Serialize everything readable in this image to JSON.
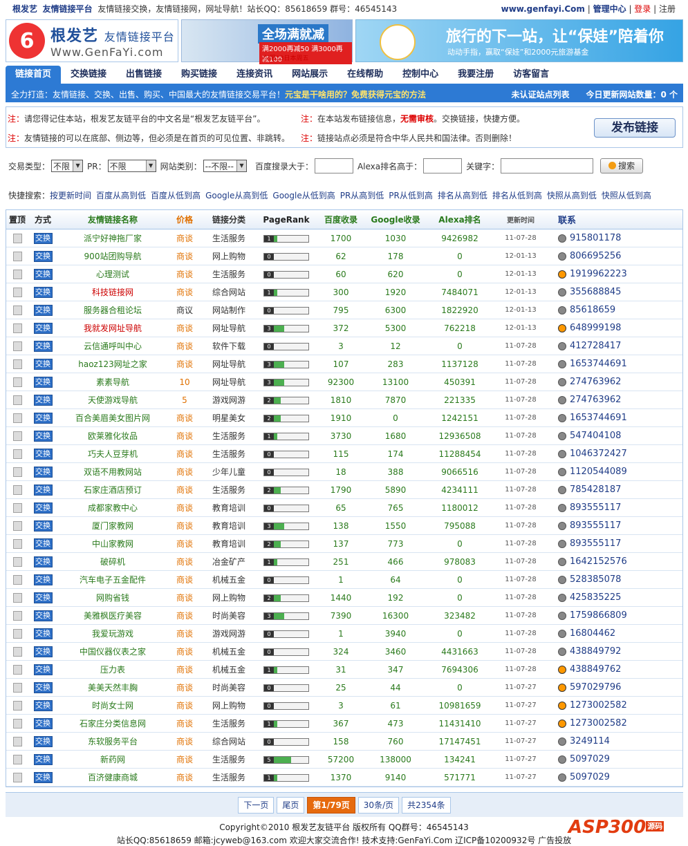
{
  "topbar": {
    "brand": "根发艺",
    "subtitle": "友情链接平台",
    "slogan": "友情链接交换，友情链接网，网址导航！站长QQ：85618659 群号：46545143",
    "site_url": "www.genfayi.Com",
    "admin": "管理中心",
    "login": "登录",
    "register": "注册"
  },
  "header": {
    "logo_cn": "根发艺",
    "logo_tag": "友情链接平台",
    "logo_en": "Www.GenFaYi.com",
    "ad1_title": "全场满就减",
    "ad1_sub": "满2000再减50 满3000再减100",
    "ad1_note": "仅限13日本周五",
    "ad2_title": "旅行的下一站，让“保娃”陪着你",
    "ad2_sub": "动动手指，赢取“保娃”和2000元旅游基金"
  },
  "nav": [
    "链接首页",
    "交换链接",
    "出售链接",
    "购买链接",
    "连接资讯",
    "网站展示",
    "在线帮助",
    "控制中心",
    "我要注册",
    "访客留言"
  ],
  "subnav": {
    "left": "全力打造：友情链接、交换、出售、购买、中国最大的友情链接交易平台！",
    "highlight": "元宝是干啥用的？免费获得元宝的方法",
    "middle": "未认证站点列表",
    "right": "今日更新网站数量：0 个"
  },
  "notice": {
    "prefix": "注：",
    "n1": "请您得记住本站，根发艺友链平台的中文名是“根发艺友链平台”。",
    "n2a": "在本站发布链接信息，",
    "n2b": "无需审核",
    "n2c": "。交换链接，快捷方便。",
    "n3": "友情链接的可以在底部、侧边等，但必须是在首页的可见位置、非跳转。",
    "n4": "链接站点必须是符合中华人民共和国法律。否则删除！",
    "publish": "发布链接"
  },
  "search": {
    "type_label": "交易类型：",
    "type_value": "不限",
    "pr_label": "PR：",
    "pr_value": "不限",
    "cat_label": "网站类别：",
    "cat_value": "--不限--",
    "baidu_label": "百度搜录大于：",
    "alexa_label": "Alexa排名高于：",
    "kw_label": "关键字：",
    "btn": "搜索"
  },
  "quick": {
    "label": "快捷搜索：",
    "items": [
      "按更新时间",
      "百度从高到低",
      "百度从低到高",
      "Google从高到低",
      "Google从低到高",
      "PR从高到低",
      "PR从低到高",
      "排名从高到低",
      "排名从低到高",
      "快照从高到低",
      "快照从低到高"
    ]
  },
  "table": {
    "headers": [
      "置顶",
      "方式",
      "友情链接名称",
      "价格",
      "链接分类",
      "PageRank",
      "百度收录",
      "Google收录",
      "Alexa排名",
      "更新时间",
      "联系"
    ],
    "mode_label": "交换",
    "rows": [
      {
        "name": "派宁好神拖厂家",
        "price": "商谈",
        "cat": "生活服务",
        "pr": 1,
        "baidu": "1700",
        "google": "1030",
        "alexa": "9426982",
        "time": "11-07-28",
        "qq": "915801178",
        "qqcolor": false
      },
      {
        "name": "900站团购导航",
        "price": "商谈",
        "cat": "网上购物",
        "pr": 0,
        "baidu": "62",
        "google": "178",
        "alexa": "0",
        "time": "12-01-13",
        "qq": "806695256",
        "qqcolor": false
      },
      {
        "name": "心理测试",
        "price": "商谈",
        "cat": "生活服务",
        "pr": 0,
        "baidu": "60",
        "google": "620",
        "alexa": "0",
        "time": "12-01-13",
        "qq": "1919962223",
        "qqcolor": true
      },
      {
        "name": "科技链接网",
        "price": "商谈",
        "cat": "综合网站",
        "pr": 1,
        "baidu": "300",
        "google": "1920",
        "alexa": "7484071",
        "time": "12-01-13",
        "qq": "355688845",
        "qqcolor": false,
        "red": true
      },
      {
        "name": "服务器合租论坛",
        "price": "商议",
        "cat": "网站制作",
        "pr": 0,
        "baidu": "795",
        "google": "6300",
        "alexa": "1822920",
        "time": "12-01-13",
        "qq": "85618659",
        "qqcolor": false,
        "blk": true
      },
      {
        "name": "我就发网址导航",
        "price": "商谈",
        "cat": "网址导航",
        "pr": 3,
        "baidu": "372",
        "google": "5300",
        "alexa": "762218",
        "time": "12-01-13",
        "qq": "648999198",
        "qqcolor": true,
        "red": true
      },
      {
        "name": "云信通呼叫中心",
        "price": "商谈",
        "cat": "软件下载",
        "pr": 0,
        "baidu": "3",
        "google": "12",
        "alexa": "0",
        "time": "11-07-28",
        "qq": "412728417",
        "qqcolor": false
      },
      {
        "name": "haoz123网址之家",
        "price": "商谈",
        "cat": "网址导航",
        "pr": 3,
        "baidu": "107",
        "google": "283",
        "alexa": "1137128",
        "time": "11-07-28",
        "qq": "1653744691",
        "qqcolor": false
      },
      {
        "name": "素素导航",
        "price": "10",
        "cat": "网址导航",
        "pr": 3,
        "baidu": "92300",
        "google": "13100",
        "alexa": "450391",
        "time": "11-07-28",
        "qq": "274763962",
        "qqcolor": false
      },
      {
        "name": "天使游戏导航",
        "price": "5",
        "cat": "游戏网游",
        "pr": 2,
        "baidu": "1810",
        "google": "7870",
        "alexa": "221335",
        "time": "11-07-28",
        "qq": "274763962",
        "qqcolor": false
      },
      {
        "name": "百合美眉美女图片网",
        "price": "商谈",
        "cat": "明星美女",
        "pr": 2,
        "baidu": "1910",
        "google": "0",
        "alexa": "1242151",
        "time": "11-07-28",
        "qq": "1653744691",
        "qqcolor": false
      },
      {
        "name": "欧莱雅化妆品",
        "price": "商谈",
        "cat": "生活服务",
        "pr": 1,
        "baidu": "3730",
        "google": "1680",
        "alexa": "12936508",
        "time": "11-07-28",
        "qq": "547404108",
        "qqcolor": false
      },
      {
        "name": "巧夫人豆芽机",
        "price": "商谈",
        "cat": "生活服务",
        "pr": 0,
        "baidu": "115",
        "google": "174",
        "alexa": "11288454",
        "time": "11-07-28",
        "qq": "1046372427",
        "qqcolor": false
      },
      {
        "name": "双语不用教网站",
        "price": "商谈",
        "cat": "少年儿童",
        "pr": 0,
        "baidu": "18",
        "google": "388",
        "alexa": "9066516",
        "time": "11-07-28",
        "qq": "1120544089",
        "qqcolor": false
      },
      {
        "name": "石家庄酒店预订",
        "price": "商谈",
        "cat": "生活服务",
        "pr": 2,
        "baidu": "1790",
        "google": "5890",
        "alexa": "4234111",
        "time": "11-07-28",
        "qq": "785428187",
        "qqcolor": false
      },
      {
        "name": "成都家教中心",
        "price": "商谈",
        "cat": "教育培训",
        "pr": 0,
        "baidu": "65",
        "google": "765",
        "alexa": "1180012",
        "time": "11-07-28",
        "qq": "893555117",
        "qqcolor": false
      },
      {
        "name": "厦门家教网",
        "price": "商谈",
        "cat": "教育培训",
        "pr": 3,
        "baidu": "138",
        "google": "1550",
        "alexa": "795088",
        "time": "11-07-28",
        "qq": "893555117",
        "qqcolor": false
      },
      {
        "name": "中山家教网",
        "price": "商谈",
        "cat": "教育培训",
        "pr": 2,
        "baidu": "137",
        "google": "773",
        "alexa": "0",
        "time": "11-07-28",
        "qq": "893555117",
        "qqcolor": false
      },
      {
        "name": "破碎机",
        "price": "商谈",
        "cat": "冶金矿产",
        "pr": 1,
        "baidu": "251",
        "google": "466",
        "alexa": "978083",
        "time": "11-07-28",
        "qq": "1642152576",
        "qqcolor": false
      },
      {
        "name": "汽车电子五金配件",
        "price": "商谈",
        "cat": "机械五金",
        "pr": 0,
        "baidu": "1",
        "google": "64",
        "alexa": "0",
        "time": "11-07-28",
        "qq": "528385078",
        "qqcolor": false
      },
      {
        "name": "网购省钱",
        "price": "商谈",
        "cat": "网上购物",
        "pr": 2,
        "baidu": "1440",
        "google": "192",
        "alexa": "0",
        "time": "11-07-28",
        "qq": "425835225",
        "qqcolor": false
      },
      {
        "name": "美雅枫医疗美容",
        "price": "商谈",
        "cat": "时尚美容",
        "pr": 3,
        "baidu": "7390",
        "google": "16300",
        "alexa": "323482",
        "time": "11-07-28",
        "qq": "1759866809",
        "qqcolor": false
      },
      {
        "name": "我爱玩游戏",
        "price": "商谈",
        "cat": "游戏网游",
        "pr": 0,
        "baidu": "1",
        "google": "3940",
        "alexa": "0",
        "time": "11-07-28",
        "qq": "16804462",
        "qqcolor": false
      },
      {
        "name": "中国仪器仪表之家",
        "price": "商谈",
        "cat": "机械五金",
        "pr": 0,
        "baidu": "324",
        "google": "3460",
        "alexa": "4431663",
        "time": "11-07-28",
        "qq": "438849792",
        "qqcolor": false
      },
      {
        "name": "压力表",
        "price": "商谈",
        "cat": "机械五金",
        "pr": 1,
        "baidu": "31",
        "google": "347",
        "alexa": "7694306",
        "time": "11-07-28",
        "qq": "438849762",
        "qqcolor": true
      },
      {
        "name": "美美天然丰胸",
        "price": "商谈",
        "cat": "时尚美容",
        "pr": 0,
        "baidu": "25",
        "google": "44",
        "alexa": "0",
        "time": "11-07-27",
        "qq": "597029796",
        "qqcolor": true
      },
      {
        "name": "时尚女士网",
        "price": "商谈",
        "cat": "网上购物",
        "pr": 0,
        "baidu": "3",
        "google": "61",
        "alexa": "10981659",
        "time": "11-07-27",
        "qq": "1273002582",
        "qqcolor": true
      },
      {
        "name": "石家庄分类信息网",
        "price": "商谈",
        "cat": "生活服务",
        "pr": 1,
        "baidu": "367",
        "google": "473",
        "alexa": "11431410",
        "time": "11-07-27",
        "qq": "1273002582",
        "qqcolor": true
      },
      {
        "name": "东软服务平台",
        "price": "商谈",
        "cat": "综合网站",
        "pr": 0,
        "baidu": "158",
        "google": "760",
        "alexa": "17147451",
        "time": "11-07-27",
        "qq": "3249114",
        "qqcolor": false
      },
      {
        "name": "新药网",
        "price": "商谈",
        "cat": "生活服务",
        "pr": 5,
        "baidu": "57200",
        "google": "138000",
        "alexa": "134241",
        "time": "11-07-27",
        "qq": "5097029",
        "qqcolor": false
      },
      {
        "name": "百济健康商城",
        "price": "商谈",
        "cat": "生活服务",
        "pr": 1,
        "baidu": "1370",
        "google": "9140",
        "alexa": "571771",
        "time": "11-07-27",
        "qq": "5097029",
        "qqcolor": false
      }
    ]
  },
  "pager": {
    "prev": "下一页",
    "last": "尾页",
    "current": "第1/79页",
    "per_page": "30条/页",
    "total": "共2354条"
  },
  "footer": {
    "line1": "Copyright©2010 根发艺友链平台 版权所有 QQ群号：46545143",
    "line2": "站长QQ:85618659 邮箱:jcyweb@163.com 欢迎大家交流合作!  技术支持:GenFaYi.Com  辽ICP备10200932号 广告投放",
    "badge": "ASP300",
    "badge_tag": "源码"
  }
}
